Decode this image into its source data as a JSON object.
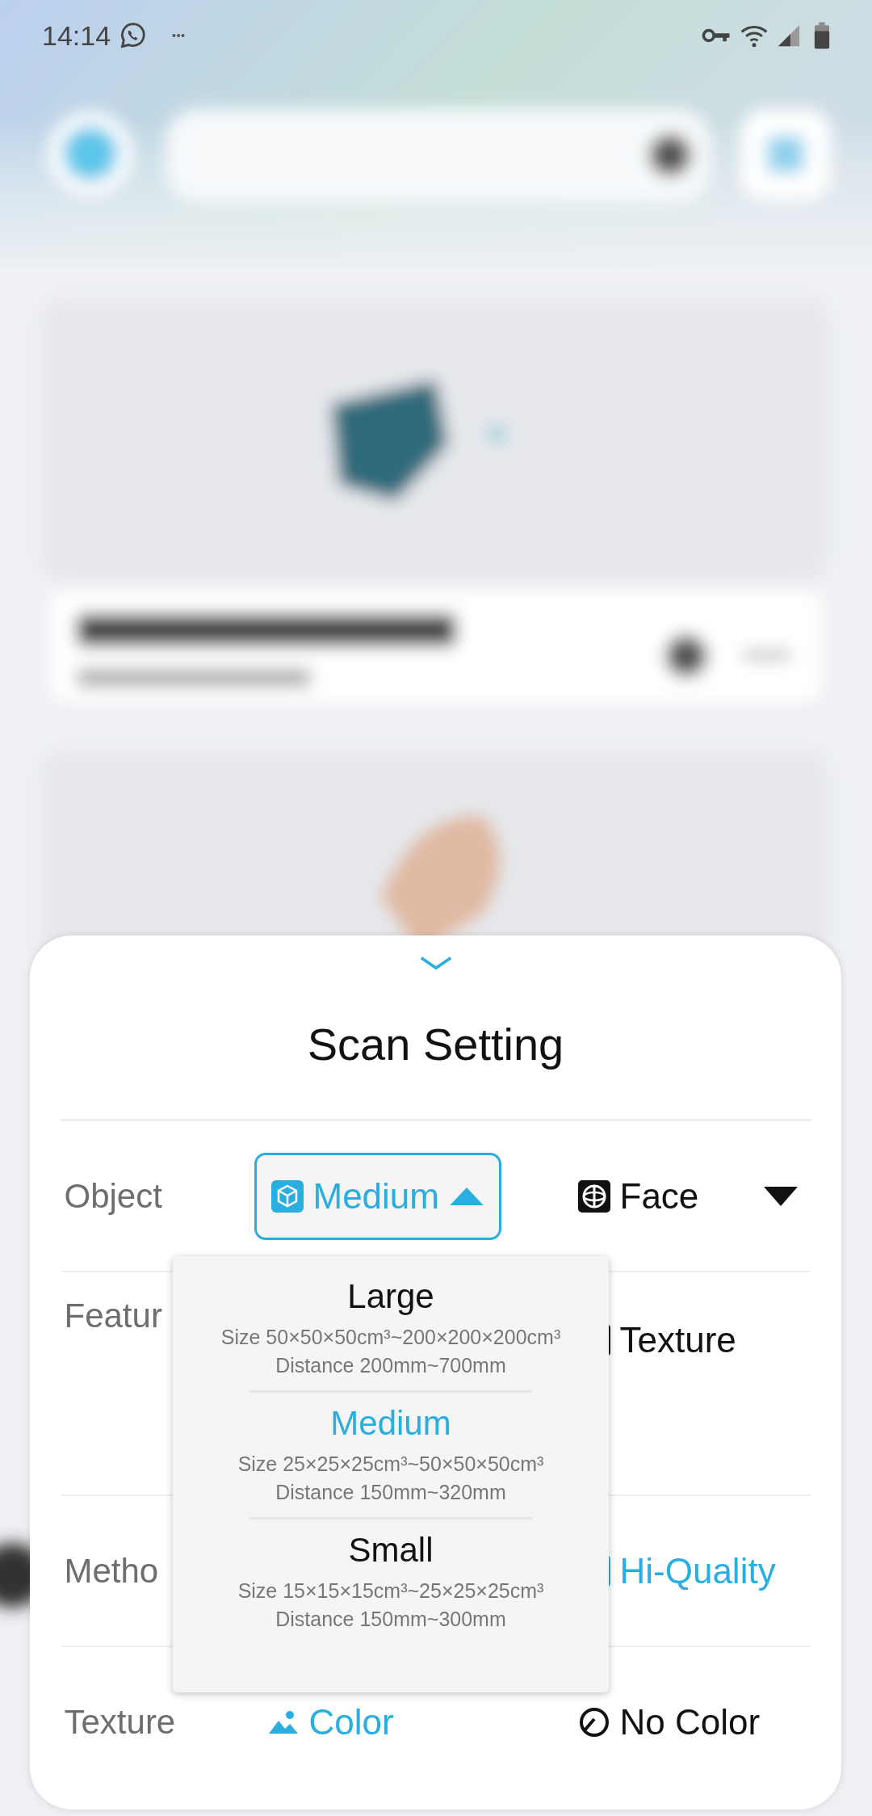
{
  "status_bar": {
    "time": "14:14"
  },
  "sheet": {
    "title": "Scan Setting",
    "rows": [
      {
        "label": "Object",
        "more_options": true,
        "options": [
          {
            "label": "Medium",
            "selected": true,
            "expanded": true
          },
          {
            "label": "Face",
            "selected": false
          }
        ]
      },
      {
        "label": "Featur",
        "options": [
          {
            "label": "Texture",
            "selected": false
          }
        ]
      },
      {
        "label": "Metho",
        "options": [
          {
            "label": "Hi-Quality",
            "selected": true
          }
        ]
      },
      {
        "label": "Texture",
        "options": [
          {
            "label": "Color",
            "selected": true
          },
          {
            "label": "No Color",
            "selected": false
          }
        ]
      }
    ]
  },
  "dropdown": {
    "items": [
      {
        "title": "Large",
        "size": "Size 50×50×50cm³~200×200×200cm³",
        "distance": "Distance 200mm~700mm",
        "selected": false
      },
      {
        "title": "Medium",
        "size": "Size 25×25×25cm³~50×50×50cm³",
        "distance": "Distance 150mm~320mm",
        "selected": true
      },
      {
        "title": "Small",
        "size": "Size 15×15×15cm³~25×25×25cm³",
        "distance": "Distance 150mm~300mm",
        "selected": false
      }
    ]
  }
}
